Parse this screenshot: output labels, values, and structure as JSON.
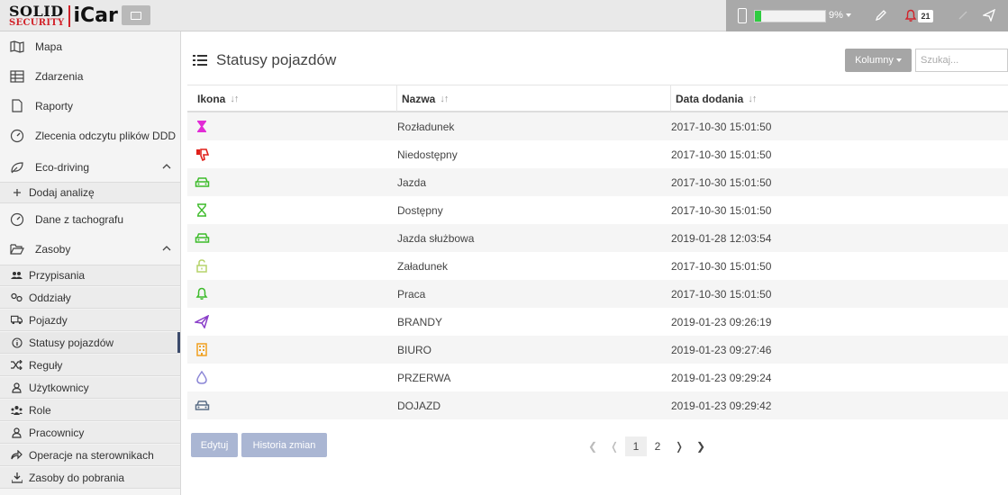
{
  "brand": {
    "logo_top": "SOLID",
    "logo_bottom": "SECURITY",
    "app_name": "iCar",
    "accent_red": "#d2232a"
  },
  "topbar": {
    "storage_percent_label": "9%",
    "storage_fraction": 0.09,
    "notifications_count": "21"
  },
  "sidebar": {
    "items": [
      {
        "label": "Mapa",
        "icon": "map-icon"
      },
      {
        "label": "Zdarzenia",
        "icon": "table-icon"
      },
      {
        "label": "Raporty",
        "icon": "file-icon"
      },
      {
        "label": "Zlecenia odczytu plików DDD",
        "icon": "gauge-icon"
      },
      {
        "label": "Eco-driving",
        "icon": "leaf-icon"
      },
      {
        "label": "Dodaj analizę",
        "icon": "plus-icon"
      },
      {
        "label": "Dane z tachografu",
        "icon": "gauge-icon"
      },
      {
        "label": "Zasoby",
        "icon": "folder-open-icon"
      }
    ],
    "sub_items": [
      {
        "label": "Przypisania",
        "icon": "users-icon"
      },
      {
        "label": "Oddziały",
        "icon": "sitemap-icon"
      },
      {
        "label": "Pojazdy",
        "icon": "truck-icon"
      },
      {
        "label": "Statusy pojazdów",
        "icon": "info-icon"
      },
      {
        "label": "Reguły",
        "icon": "shuffle-icon"
      },
      {
        "label": "Użytkownicy",
        "icon": "user-icon"
      },
      {
        "label": "Role",
        "icon": "roles-icon"
      },
      {
        "label": "Pracownicy",
        "icon": "user-icon"
      },
      {
        "label": "Operacje na sterownikach",
        "icon": "share-icon"
      },
      {
        "label": "Zasoby do pobrania",
        "icon": "download-icon"
      }
    ]
  },
  "main": {
    "title": "Statusy pojazdów",
    "columns_button": "Kolumny",
    "search_placeholder": "Szukaj...",
    "headers": {
      "icon": "Ikona",
      "name": "Nazwa",
      "date": "Data dodania"
    },
    "rows": [
      {
        "icon": "hourglass-icon",
        "color": "#e22bd6",
        "name": "Rozładunek",
        "date": "2017-10-30 15:01:50"
      },
      {
        "icon": "thumbs-down-icon",
        "color": "#e0201a",
        "name": "Niedostępny",
        "date": "2017-10-30 15:01:50"
      },
      {
        "icon": "car-icon",
        "color": "#3dbb2a",
        "name": "Jazda",
        "date": "2017-10-30 15:01:50"
      },
      {
        "icon": "hourglass-outline-icon",
        "color": "#3dbb2a",
        "name": "Dostępny",
        "date": "2017-10-30 15:01:50"
      },
      {
        "icon": "car-icon",
        "color": "#3dbb2a",
        "name": "Jazda służbowa",
        "date": "2019-01-28 12:03:54"
      },
      {
        "icon": "unlock-icon",
        "color": "#b6d36a",
        "name": "Załadunek",
        "date": "2017-10-30 15:01:50"
      },
      {
        "icon": "bell-icon",
        "color": "#3dbb2a",
        "name": "Praca",
        "date": "2017-10-30 15:01:50"
      },
      {
        "icon": "paper-plane-icon",
        "color": "#8a3ec9",
        "name": "BRANDY",
        "date": "2019-01-23 09:26:19"
      },
      {
        "icon": "building-icon",
        "color": "#f0a020",
        "name": "BIURO",
        "date": "2019-01-23 09:27:46"
      },
      {
        "icon": "tint-icon",
        "color": "#8b86d6",
        "name": "PRZERWA",
        "date": "2019-01-23 09:29:24"
      },
      {
        "icon": "car-icon",
        "color": "#5b6e86",
        "name": "DOJAZD",
        "date": "2019-01-23 09:29:42"
      }
    ],
    "edit_button": "Edytuj",
    "history_button": "Historia zmian",
    "pagination": {
      "first": "❮",
      "prev": "❬",
      "pages": [
        "1",
        "2"
      ],
      "next": "❭",
      "last": "❯"
    }
  }
}
